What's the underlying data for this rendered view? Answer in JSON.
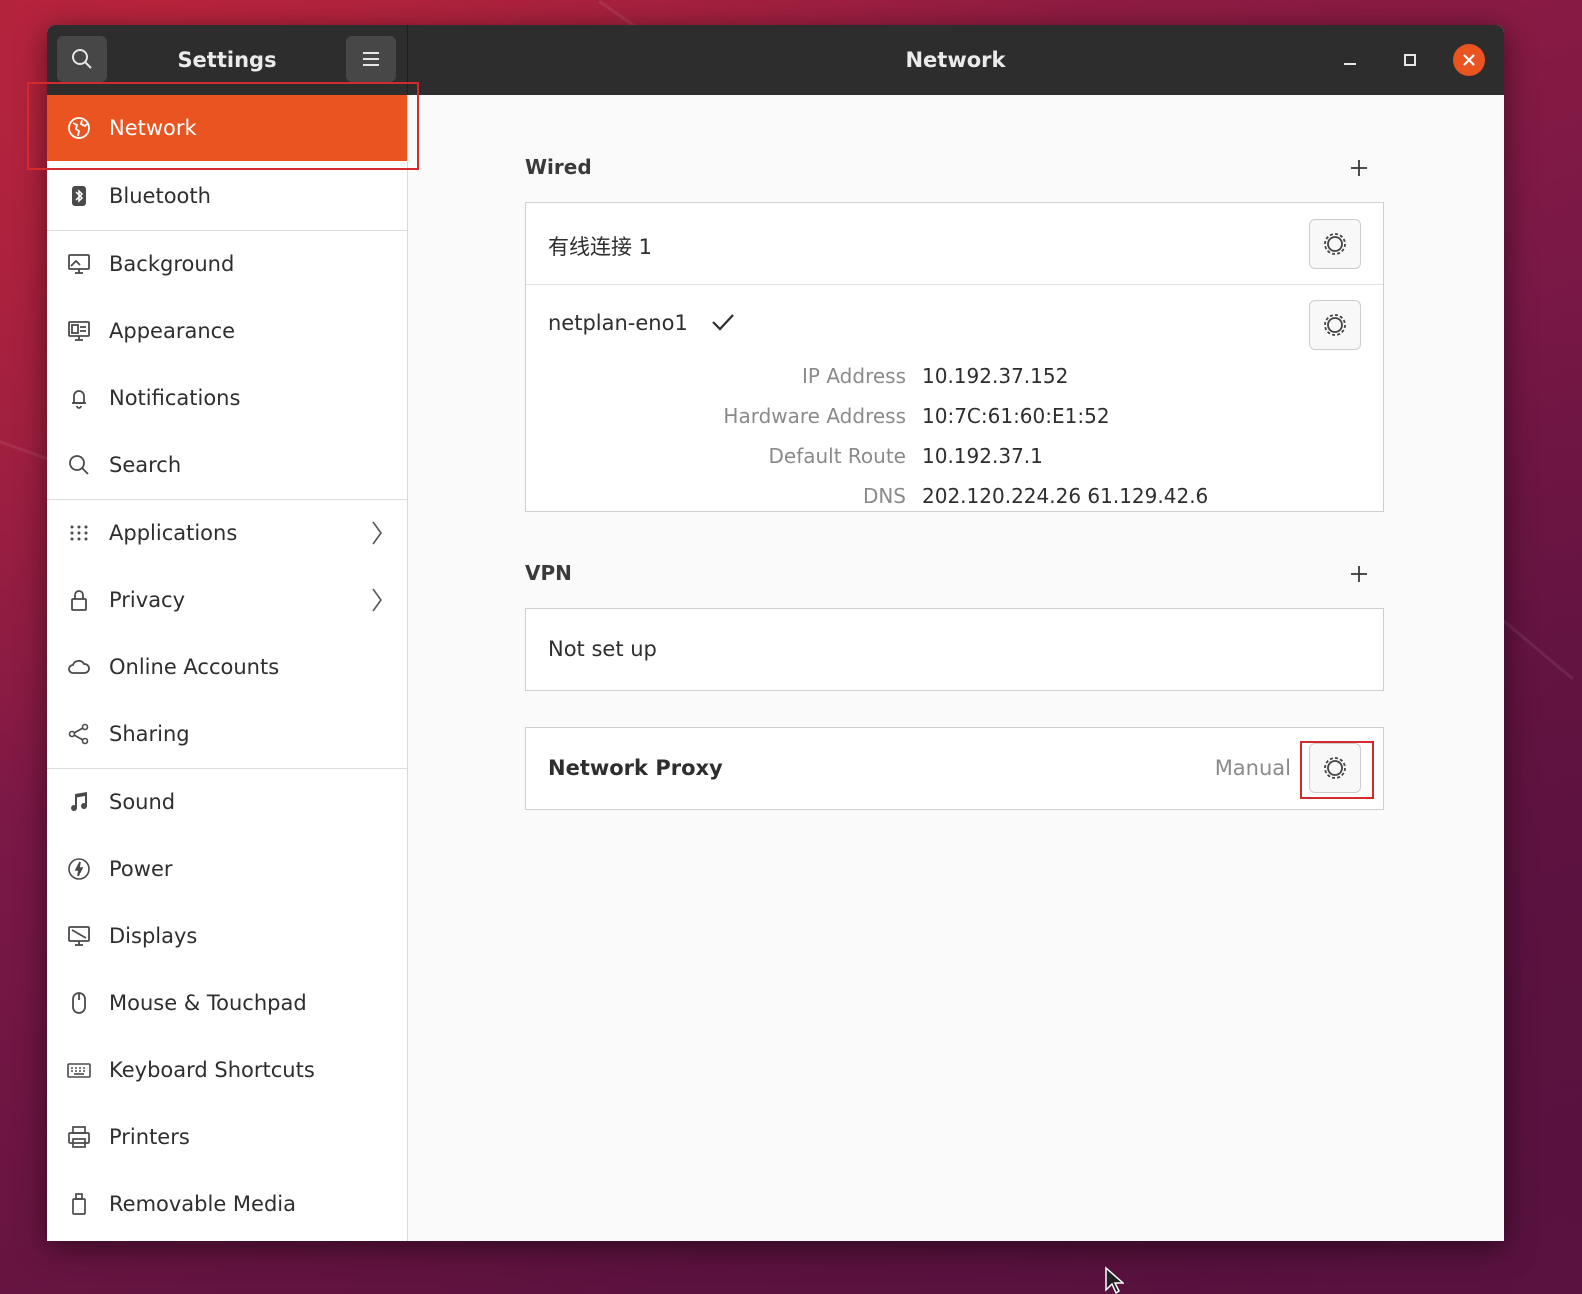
{
  "titlebar": {
    "app_title": "Settings",
    "page_title": "Network"
  },
  "sidebar": {
    "items": [
      {
        "label": "Network",
        "icon": "network-icon"
      },
      {
        "label": "Bluetooth",
        "icon": "bluetooth-icon"
      },
      {
        "label": "Background",
        "icon": "background-icon"
      },
      {
        "label": "Appearance",
        "icon": "appearance-icon"
      },
      {
        "label": "Notifications",
        "icon": "bell-icon"
      },
      {
        "label": "Search",
        "icon": "search-icon"
      },
      {
        "label": "Applications",
        "icon": "grid-icon"
      },
      {
        "label": "Privacy",
        "icon": "lock-icon"
      },
      {
        "label": "Online Accounts",
        "icon": "cloud-icon"
      },
      {
        "label": "Sharing",
        "icon": "share-icon"
      },
      {
        "label": "Sound",
        "icon": "music-note-icon"
      },
      {
        "label": "Power",
        "icon": "power-icon"
      },
      {
        "label": "Displays",
        "icon": "display-icon"
      },
      {
        "label": "Mouse & Touchpad",
        "icon": "mouse-icon"
      },
      {
        "label": "Keyboard Shortcuts",
        "icon": "keyboard-icon"
      },
      {
        "label": "Printers",
        "icon": "printer-icon"
      },
      {
        "label": "Removable Media",
        "icon": "usb-drive-icon"
      }
    ]
  },
  "wired": {
    "title": "Wired",
    "connection1": "有线连接 1",
    "connection2": "netplan-eno1",
    "details": {
      "ip_label": "IP Address",
      "ip_value": "10.192.37.152",
      "hw_label": "Hardware Address",
      "hw_value": "10:7C:61:60:E1:52",
      "route_label": "Default Route",
      "route_value": "10.192.37.1",
      "dns_label": "DNS",
      "dns_value": "202.120.224.26 61.129.42.6"
    }
  },
  "vpn": {
    "title": "VPN",
    "status": "Not set up"
  },
  "proxy": {
    "title": "Network Proxy",
    "status": "Manual"
  },
  "colors": {
    "accent": "#e95420",
    "titlebar": "#2d2d2d",
    "annotation": "#d62a2a"
  }
}
